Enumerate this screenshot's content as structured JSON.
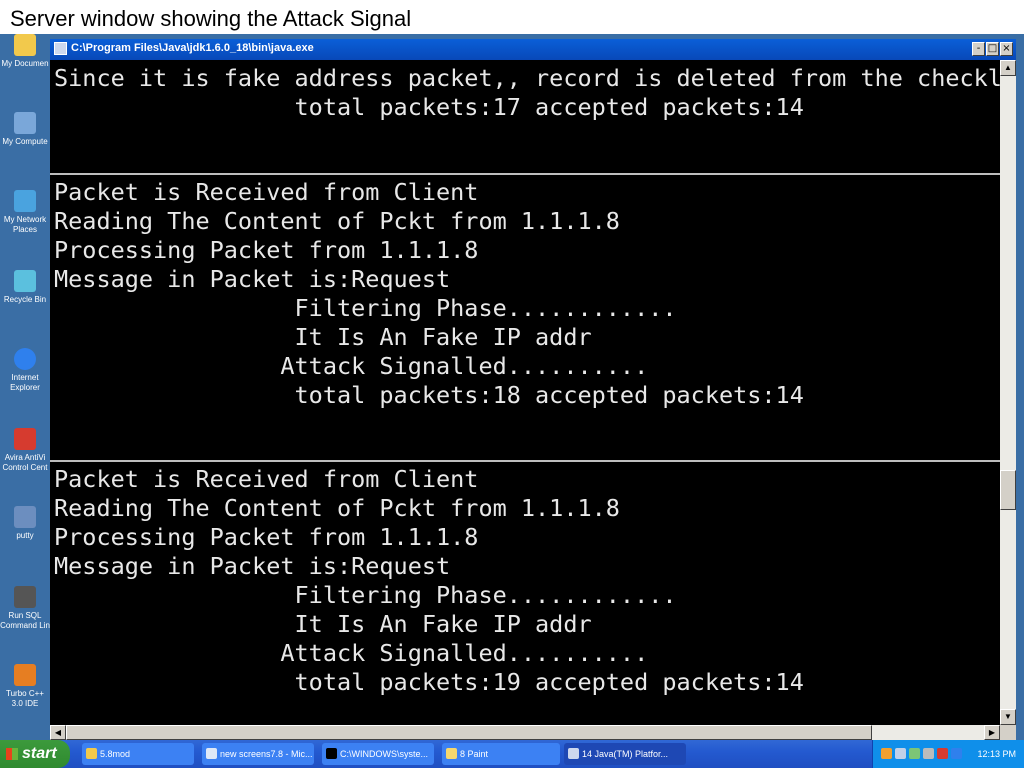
{
  "caption": "Server window showing the Attack Signal",
  "desktop_icons": [
    {
      "label": "My Documen",
      "icon": "folder-documents-icon",
      "color": "#f2c94c"
    },
    {
      "label": "My Compute",
      "icon": "computer-icon",
      "color": "#7aa7d9"
    },
    {
      "label": "My Network\nPlaces",
      "icon": "network-icon",
      "color": "#4aa3df"
    },
    {
      "label": "Recycle Bin",
      "icon": "recycle-bin-icon",
      "color": "#5bc0de"
    },
    {
      "label": "Internet\nExplorer",
      "icon": "internet-explorer-icon",
      "color": "#2f80ed"
    },
    {
      "label": "Avira AntiVi\nControl Cent",
      "icon": "avira-icon",
      "color": "#d63b2f"
    },
    {
      "label": "putty",
      "icon": "putty-icon",
      "color": "#6c8ebf"
    },
    {
      "label": "Run SQL\nCommand Lin",
      "icon": "sql-icon",
      "color": "#555555"
    },
    {
      "label": "Turbo C++\n3.0 IDE",
      "icon": "turbo-cpp-icon",
      "color": "#e67e22"
    }
  ],
  "window": {
    "title": "C:\\Program Files\\Java\\jdk1.6.0_18\\bin\\java.exe",
    "buttons": {
      "minimize": "-",
      "maximize": "□",
      "close": "×"
    }
  },
  "console": {
    "blocks": [
      [
        "Since it is fake address packet,, record is deleted from the checklist",
        "                 total packets:17 accepted packets:14"
      ],
      [
        "Packet is Received from Client",
        "Reading The Content of Pckt from 1.1.1.8",
        "Processing Packet from 1.1.1.8",
        "Message in Packet is:Request",
        "                 Filtering Phase............",
        "                 It Is An Fake IP addr",
        "                Attack Signalled..........",
        "                 total packets:18 accepted packets:14"
      ],
      [
        "Packet is Received from Client",
        "Reading The Content of Pckt from 1.1.1.8",
        "Processing Packet from 1.1.1.8",
        "Message in Packet is:Request",
        "                 Filtering Phase............",
        "                 It Is An Fake IP addr",
        "                Attack Signalled..........",
        "                 total packets:19 accepted packets:14"
      ]
    ]
  },
  "taskbar": {
    "start_label": "start",
    "tasks": [
      {
        "label": "5.8mod",
        "icon": "folder-icon",
        "active": false
      },
      {
        "label": "new screens7.8 - Mic...",
        "icon": "word-icon",
        "active": false
      },
      {
        "label": "C:\\WINDOWS\\syste...",
        "icon": "cmd-icon",
        "active": false
      },
      {
        "label": "8 Paint",
        "icon": "paint-icon",
        "active": false
      },
      {
        "label": "14 Java(TM) Platfor...",
        "icon": "java-icon",
        "active": true
      }
    ],
    "clock": "12:13 PM"
  }
}
